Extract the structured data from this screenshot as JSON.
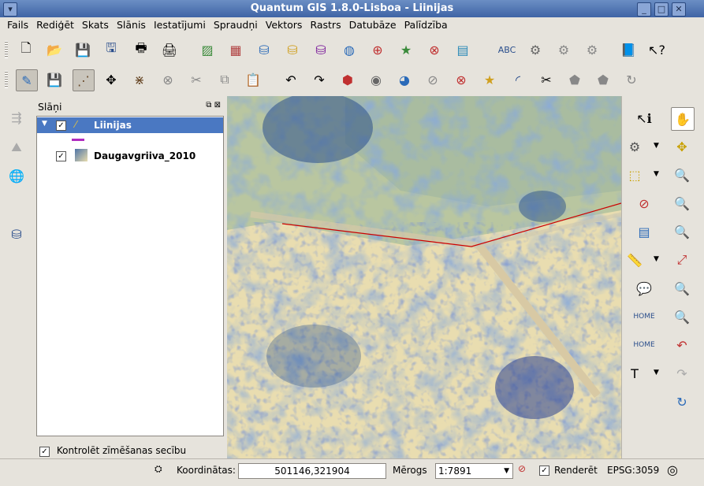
{
  "window": {
    "title": "Quantum GIS 1.8.0-Lisboa - Liinijas"
  },
  "menubar": {
    "items": [
      "Fails",
      "Rediģēt",
      "Skats",
      "Slānis",
      "Iestatījumi",
      "Spraudņi",
      "Vektors",
      "Rastrs",
      "Datubāze",
      "Palīdzība"
    ]
  },
  "layers_panel": {
    "title": "Slāņi",
    "layers": [
      {
        "name": "Liinijas",
        "checked": true,
        "selected": true
      },
      {
        "name": "Daugavgriiva_2010",
        "checked": true,
        "selected": false
      }
    ],
    "draw_order_checkbox": {
      "label": "Kontrolēt zīmēšanas secību",
      "checked": true
    }
  },
  "statusbar": {
    "coordinates_label": "Koordinātas:",
    "coordinates_value": "501146,321904",
    "scale_label": "Mērogs",
    "scale_value": "1:7891",
    "render_label": "Renderēt",
    "render_checked": true,
    "crs": "EPSG:3059"
  },
  "colors": {
    "selection": "#4a78c2",
    "line_layer": "#cc0000",
    "legend_swatch": "#b02cc0"
  }
}
